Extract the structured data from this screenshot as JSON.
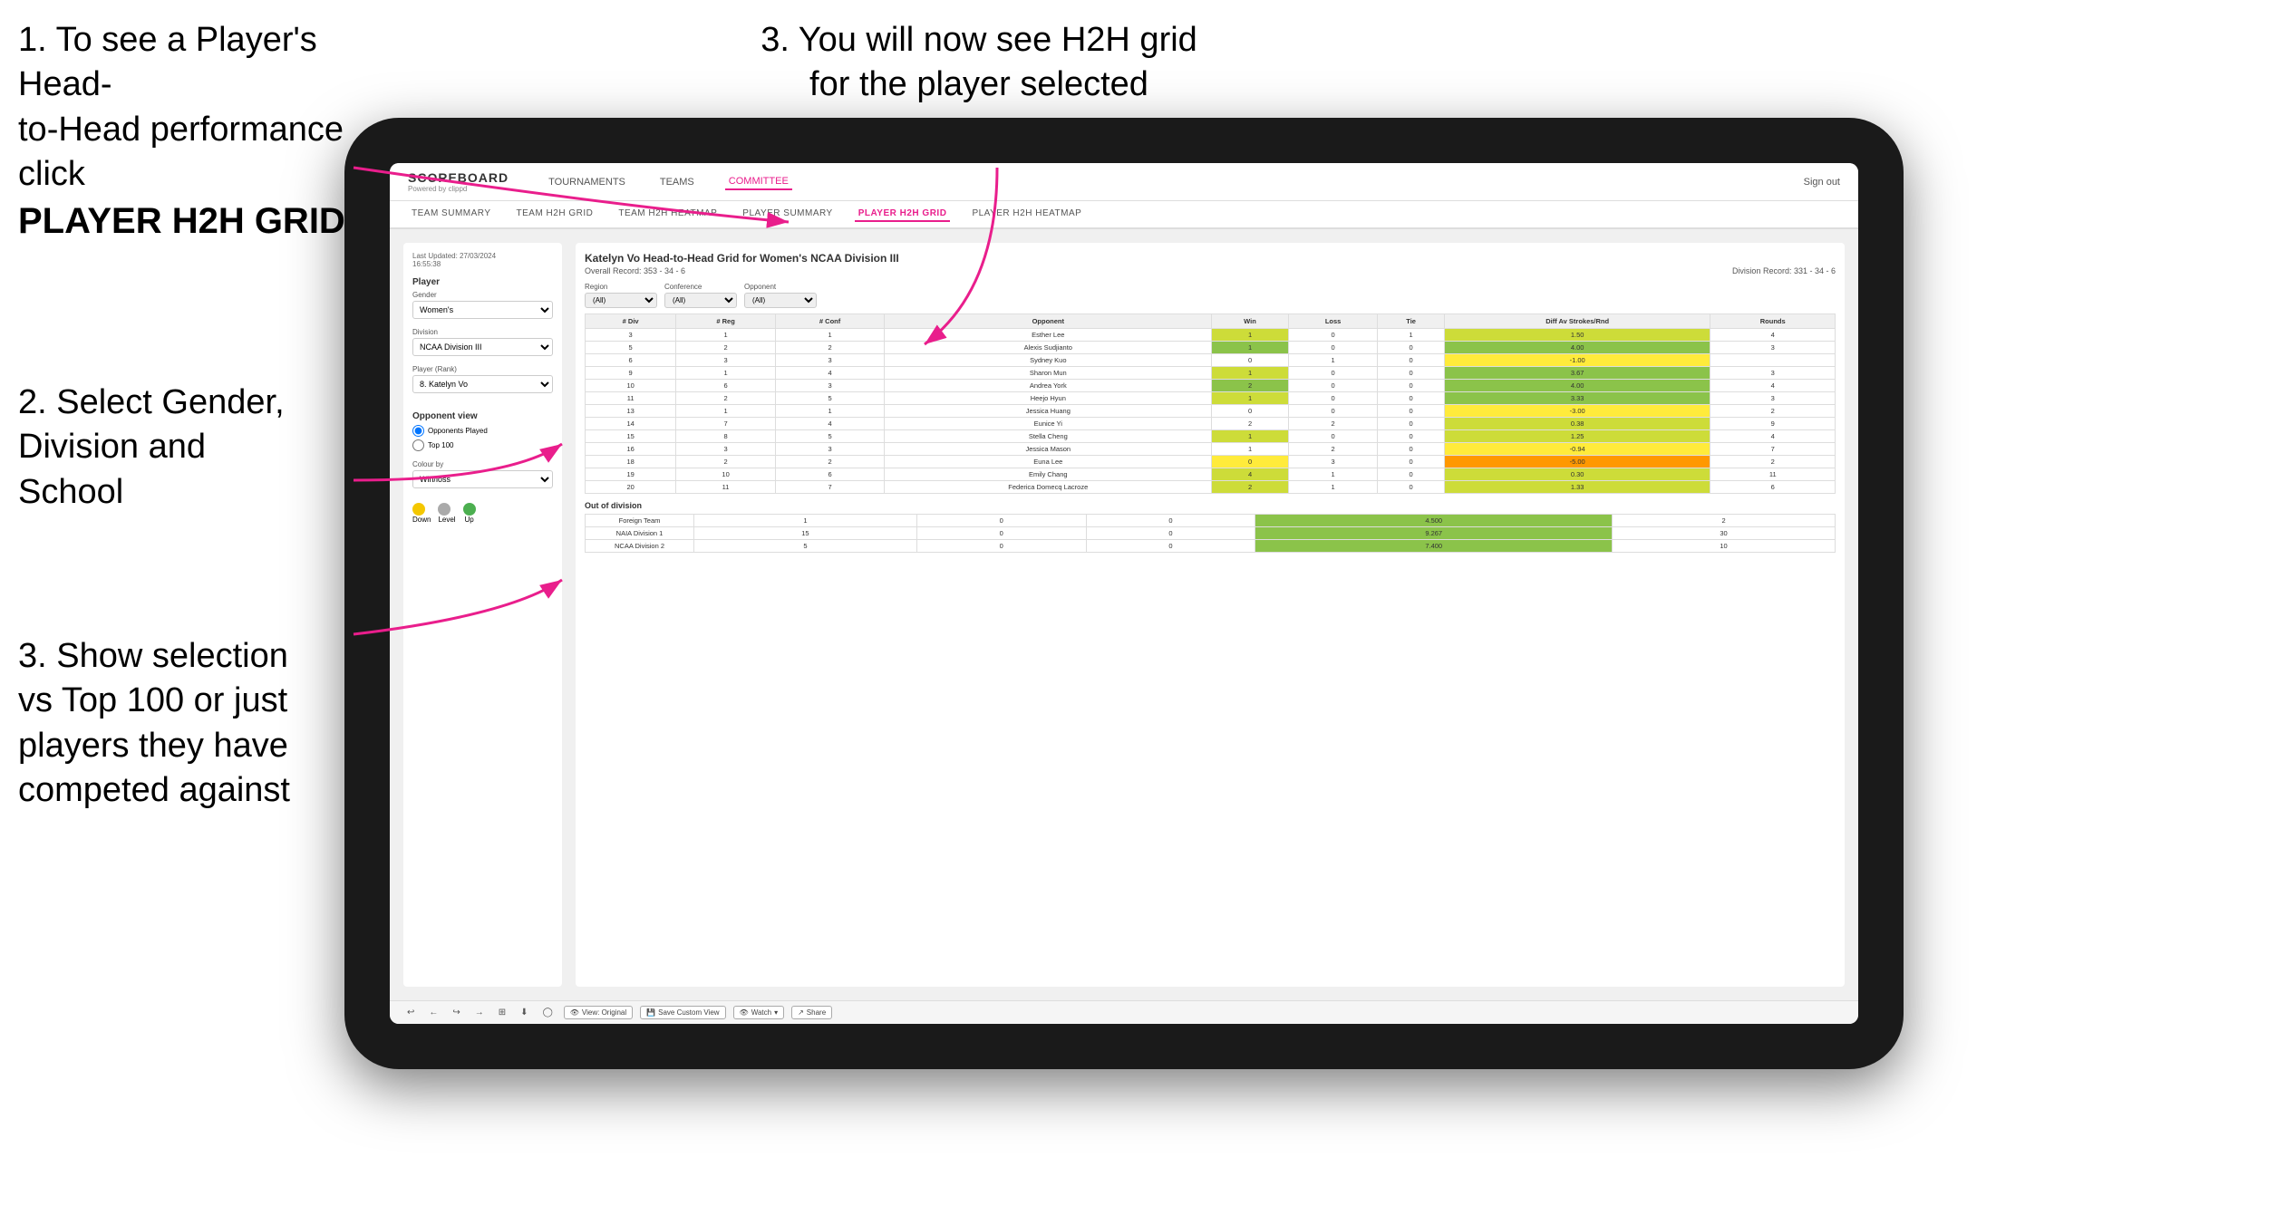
{
  "instructions": {
    "step1_line1": "1. To see a Player's Head-",
    "step1_line2": "to-Head performance click",
    "step1_bold": "PLAYER H2H GRID",
    "step3_top_line1": "3. You will now see H2H grid",
    "step3_top_line2": "for the player selected",
    "step2_line1": "2. Select Gender,",
    "step2_line2": "Division and",
    "step2_line3": "School",
    "step3_bottom_line1": "3. Show selection",
    "step3_bottom_line2": "vs Top 100 or just",
    "step3_bottom_line3": "players they have",
    "step3_bottom_line4": "competed against"
  },
  "nav": {
    "logo": "SCOREBOARD",
    "logo_sub": "Powered by clippd",
    "links": [
      "TOURNAMENTS",
      "TEAMS",
      "COMMITTEE"
    ],
    "active_link": "COMMITTEE",
    "sign_in": "Sign out"
  },
  "sub_nav": {
    "links": [
      "TEAM SUMMARY",
      "TEAM H2H GRID",
      "TEAM H2H HEATMAP",
      "PLAYER SUMMARY",
      "PLAYER H2H GRID",
      "PLAYER H2H HEATMAP"
    ],
    "active": "PLAYER H2H GRID"
  },
  "left_panel": {
    "timestamp": "Last Updated: 27/03/2024",
    "timestamp2": "16:55:38",
    "player_label": "Player",
    "gender_label": "Gender",
    "gender_value": "Women's",
    "division_label": "Division",
    "division_value": "NCAA Division III",
    "player_rank_label": "Player (Rank)",
    "player_rank_value": "8. Katelyn Vo",
    "opponent_view_label": "Opponent view",
    "radio_1": "Opponents Played",
    "radio_2": "Top 100",
    "colour_by_label": "Colour by",
    "colour_by_value": "Win/loss",
    "legend": [
      {
        "label": "Down",
        "color": "#f4c700"
      },
      {
        "label": "Level",
        "color": "#aaa"
      },
      {
        "label": "Up",
        "color": "#4CAF50"
      }
    ]
  },
  "grid": {
    "title": "Katelyn Vo Head-to-Head Grid for Women's NCAA Division III",
    "overall_record": "Overall Record: 353 - 34 - 6",
    "division_record": "Division Record: 331 - 34 - 6",
    "opponents_label": "Opponents:",
    "opponents_value": "(All)",
    "region_label": "Region",
    "conference_label": "Conference",
    "opponent_label": "Opponent",
    "columns": [
      "# Div",
      "# Reg",
      "# Conf",
      "Opponent",
      "Win",
      "Loss",
      "Tie",
      "Diff Av Strokes/Rnd",
      "Rounds"
    ],
    "rows": [
      {
        "div": 3,
        "reg": 1,
        "conf": 1,
        "opponent": "Esther Lee",
        "win": 1,
        "loss": 0,
        "tie": 1,
        "diff": "1.50",
        "rounds": 4,
        "win_class": "win-low"
      },
      {
        "div": 5,
        "reg": 2,
        "conf": 2,
        "opponent": "Alexis Sudjianto",
        "win": 1,
        "loss": 0,
        "tie": 0,
        "diff": "4.00",
        "rounds": 3,
        "win_class": "win-med"
      },
      {
        "div": 6,
        "reg": 3,
        "conf": 3,
        "opponent": "Sydney Kuo",
        "win": 0,
        "loss": 1,
        "tie": 0,
        "diff": "-1.00",
        "rounds": "",
        "win_class": "loss-low"
      },
      {
        "div": 9,
        "reg": 1,
        "conf": 4,
        "opponent": "Sharon Mun",
        "win": 1,
        "loss": 0,
        "tie": 0,
        "diff": "3.67",
        "rounds": 3,
        "win_class": "win-low"
      },
      {
        "div": 10,
        "reg": 6,
        "conf": 3,
        "opponent": "Andrea York",
        "win": 2,
        "loss": 0,
        "tie": 0,
        "diff": "4.00",
        "rounds": 4,
        "win_class": "win-med"
      },
      {
        "div": 11,
        "reg": 2,
        "conf": 5,
        "opponent": "Heejo Hyun",
        "win": 1,
        "loss": 0,
        "tie": 0,
        "diff": "3.33",
        "rounds": 3,
        "win_class": "win-low"
      },
      {
        "div": 13,
        "reg": 1,
        "conf": 1,
        "opponent": "Jessica Huang",
        "win": 0,
        "loss": 0,
        "tie": 0,
        "diff": "-3.00",
        "rounds": 2,
        "win_class": "loss-low"
      },
      {
        "div": 14,
        "reg": 7,
        "conf": 4,
        "opponent": "Eunice Yi",
        "win": 2,
        "loss": 2,
        "tie": 0,
        "diff": "0.38",
        "rounds": 9,
        "win_class": "neutral"
      },
      {
        "div": 15,
        "reg": 8,
        "conf": 5,
        "opponent": "Stella Cheng",
        "win": 1,
        "loss": 0,
        "tie": 0,
        "diff": "1.25",
        "rounds": 4,
        "win_class": "win-low"
      },
      {
        "div": 16,
        "reg": 3,
        "conf": 3,
        "opponent": "Jessica Mason",
        "win": 1,
        "loss": 2,
        "tie": 0,
        "diff": "-0.94",
        "rounds": 7,
        "win_class": "loss-low"
      },
      {
        "div": 18,
        "reg": 2,
        "conf": 2,
        "opponent": "Euna Lee",
        "win": 0,
        "loss": 3,
        "tie": 0,
        "diff": "-5.00",
        "rounds": 2,
        "win_class": "loss-med"
      },
      {
        "div": 19,
        "reg": 10,
        "conf": 6,
        "opponent": "Emily Chang",
        "win": 4,
        "loss": 1,
        "tie": 0,
        "diff": "0.30",
        "rounds": 11,
        "win_class": "win-low"
      },
      {
        "div": 20,
        "reg": 11,
        "conf": 7,
        "opponent": "Federica Domecq Lacroze",
        "win": 2,
        "loss": 1,
        "tie": 0,
        "diff": "1.33",
        "rounds": 6,
        "win_class": "win-low"
      }
    ],
    "out_of_division_label": "Out of division",
    "out_rows": [
      {
        "label": "Foreign Team",
        "win": 1,
        "loss": 0,
        "tie": 0,
        "diff": "4.500",
        "rounds": 2
      },
      {
        "label": "NAIA Division 1",
        "win": 15,
        "loss": 0,
        "tie": 0,
        "diff": "9.267",
        "rounds": 30
      },
      {
        "label": "NCAA Division 2",
        "win": 5,
        "loss": 0,
        "tie": 0,
        "diff": "7.400",
        "rounds": 10
      }
    ]
  },
  "toolbar": {
    "buttons": [
      "↩",
      "←",
      "↪",
      "→",
      "⊞",
      "↙",
      "◯",
      "🔄"
    ],
    "view_original": "View: Original",
    "save_custom": "Save Custom View",
    "watch": "Watch",
    "share": "Share"
  }
}
